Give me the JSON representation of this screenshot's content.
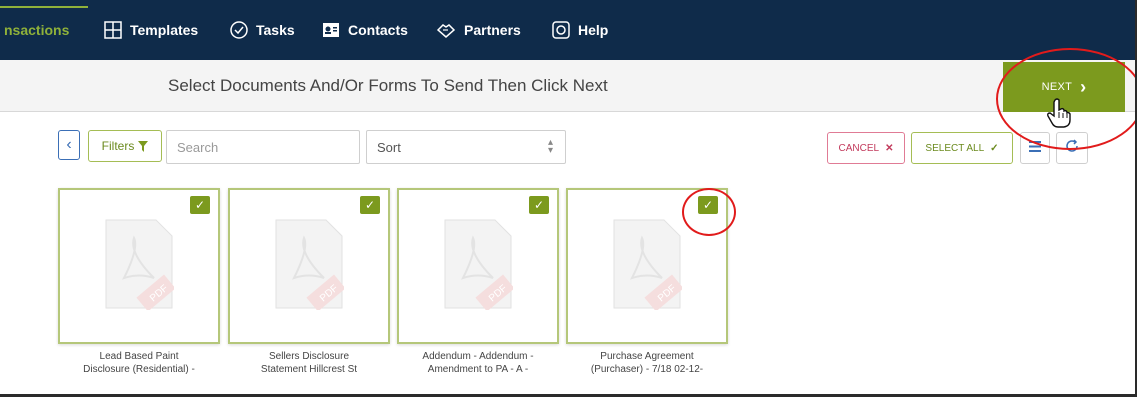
{
  "nav": {
    "items": [
      {
        "label": "nsactions",
        "icon": "none"
      },
      {
        "label": "Templates",
        "icon": "grid-icon"
      },
      {
        "label": "Tasks",
        "icon": "check-circle-icon"
      },
      {
        "label": "Contacts",
        "icon": "contact-card-icon"
      },
      {
        "label": "Partners",
        "icon": "handshake-icon"
      },
      {
        "label": "Help",
        "icon": "lifebuoy-icon"
      }
    ]
  },
  "header": {
    "title": "Select Documents And/Or Forms To Send Then Click Next",
    "next_label": "NEXT"
  },
  "toolbar": {
    "back_icon": "chevron-left-icon",
    "filters_label": "Filters",
    "search_placeholder": "Search",
    "sort_label": "Sort",
    "cancel_label": "CANCEL",
    "select_all_label": "SELECT ALL"
  },
  "documents": [
    {
      "title_line1": "Lead Based Paint",
      "title_line2": "Disclosure (Residential) -",
      "checked": true
    },
    {
      "title_line1": "Sellers Disclosure",
      "title_line2": "Statement Hillcrest St",
      "checked": true
    },
    {
      "title_line1": "Addendum - Addendum -",
      "title_line2": "Amendment to PA - A -",
      "checked": true
    },
    {
      "title_line1": "Purchase Agreement",
      "title_line2": "(Purchaser) - 7/18 02-12-",
      "checked": true
    }
  ],
  "colors": {
    "nav_bg": "#0f2b4a",
    "accent_green": "#7c9a1e",
    "cancel_pink": "#c23a5c",
    "annotation_red": "#e11b1b"
  }
}
